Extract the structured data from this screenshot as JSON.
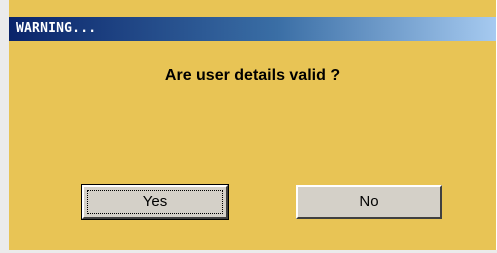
{
  "dialog": {
    "title": "WARNING...",
    "message": "Are user details valid ?",
    "buttons": {
      "yes_label": "Yes",
      "no_label": "No"
    }
  },
  "colors": {
    "background": "#e8c455",
    "titlebar_start": "#0a246a",
    "titlebar_end": "#a6caf0",
    "button_face": "#d4d0c8"
  }
}
